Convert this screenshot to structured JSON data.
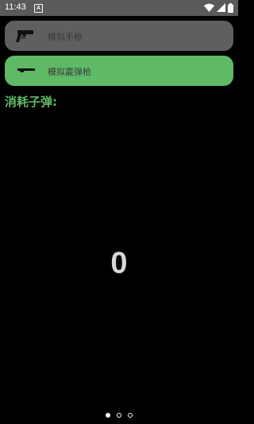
{
  "status_bar": {
    "time": "11:43",
    "app_notification_letter": "A",
    "icons": [
      "wifi-icon",
      "signal-icon",
      "battery-icon"
    ]
  },
  "weapons": [
    {
      "label": "模拟手枪",
      "icon": "pistol-icon",
      "selected": false
    },
    {
      "label": "模拟霰弹枪",
      "icon": "shotgun-icon",
      "selected": true
    }
  ],
  "ammo": {
    "label": "消耗子弹:",
    "count": "0"
  },
  "pager": {
    "pages": 3,
    "active_index": 0
  },
  "colors": {
    "background": "#000000",
    "status_bar": "#5a5a5a",
    "unselected_row": "#5f5f5f",
    "selected_row": "#5fba67",
    "accent_text": "#5fba67",
    "counter_text": "#d7d7d7"
  }
}
